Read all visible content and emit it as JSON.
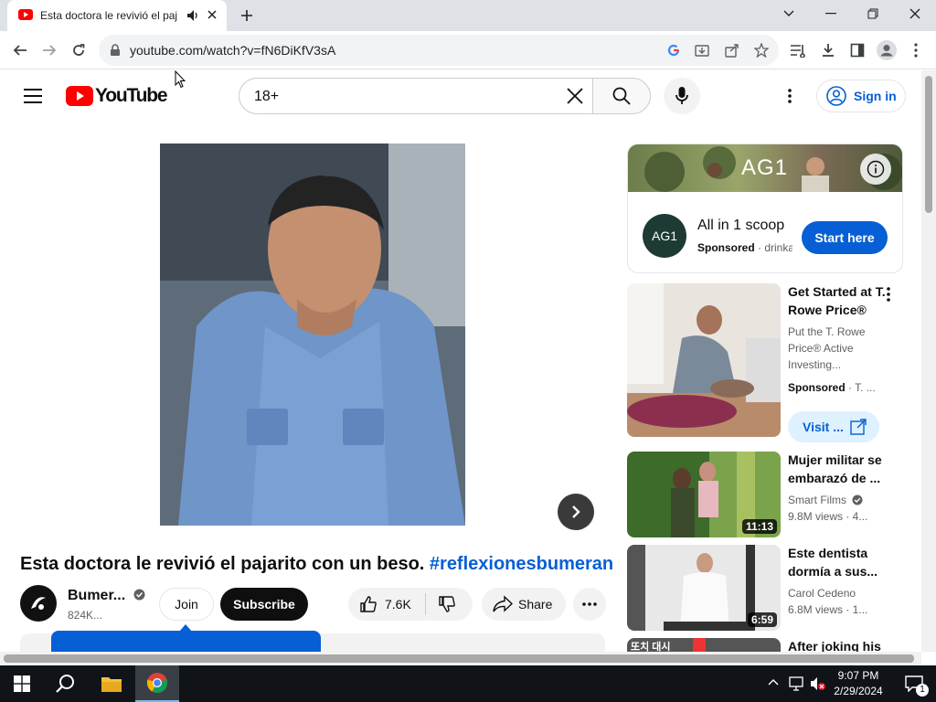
{
  "browser": {
    "tab_title": "Esta doctora le revivió el paj",
    "url": "youtube.com/watch?v=fN6DiKfV3sA"
  },
  "header": {
    "logo_text": "YouTube",
    "search_value": "18+",
    "signin_label": "Sign in"
  },
  "video": {
    "title_main": "Esta doctora le revivió el pajarito con un beso.",
    "title_hashtag": "#reflexionesbumeran",
    "channel_name": "Bumer...",
    "subscribers": "824K...",
    "join_label": "Join",
    "subscribe_label": "Subscribe",
    "likes": "7.6K",
    "share_label": "Share"
  },
  "sidebar": {
    "ad": {
      "banner_logo": "AG1",
      "logo_text": "AG1",
      "headline": "All in 1 scoop",
      "sponsored": "Sponsored",
      "domain": "· drinka",
      "cta": "Start here"
    },
    "ad2": {
      "title": "Get Started at T. Rowe Price®",
      "desc": "Put the T. Rowe Price® Active Investing...",
      "sponsored": "Sponsored",
      "domain": "· T. ...",
      "visit_label": "Visit ..."
    },
    "items": [
      {
        "title": "Mujer militar se embarazó de ...",
        "channel": "Smart Films",
        "meta": "9.8M views · 4...",
        "duration": "11:13"
      },
      {
        "title": "Este dentista dormía a sus...",
        "channel": "Carol Cedeno",
        "meta": "6.8M views · 1...",
        "duration": "6:59"
      },
      {
        "title": "After joking his",
        "thumb_text": "또치 대시"
      }
    ]
  },
  "taskbar": {
    "time": "9:07 PM",
    "date": "2/29/2024",
    "notification_count": "1"
  },
  "colors": {
    "yt_red": "#ff0000",
    "link_blue": "#065fd4",
    "taskbar": "#101418"
  }
}
